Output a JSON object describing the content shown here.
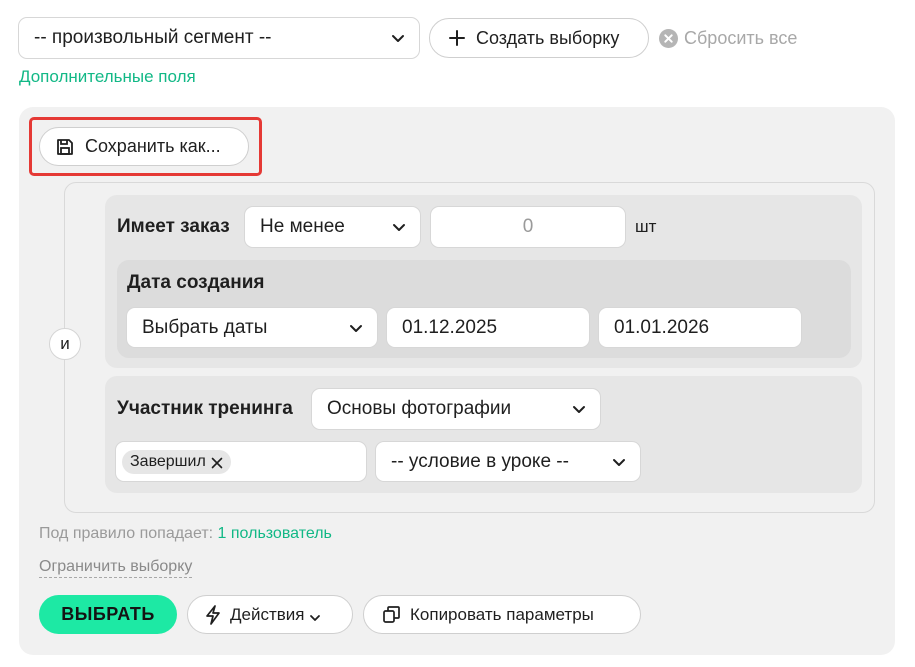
{
  "segment_select": {
    "value": "-- произвольный сегмент --"
  },
  "create_selection_button": {
    "label": "Создать выборку"
  },
  "reset_all": {
    "label": "Сбросить все"
  },
  "extra_fields_link": {
    "label": "Дополнительные поля"
  },
  "save_as_button": {
    "label": "Сохранить как..."
  },
  "and_badge": {
    "label": "и"
  },
  "order_condition": {
    "label": "Имеет заказ",
    "operator": "Не менее",
    "amount_value": "0",
    "unit": "шт",
    "date_group": {
      "label": "Дата создания",
      "date_mode": "Выбрать даты",
      "date_from": "01.12.2025",
      "date_to": "01.01.2026"
    }
  },
  "training_condition": {
    "label": "Участник тренинга",
    "training": "Основы фотографии",
    "status_tag": "Завершил",
    "lesson_condition": "-- условие в уроке --"
  },
  "summary": {
    "prefix": "Под правило попадает:",
    "count_link": "1 пользователь"
  },
  "limit_link": {
    "label": "Ограничить выборку"
  },
  "select_button": {
    "label": "ВЫБРАТЬ"
  },
  "actions_button": {
    "label": "Действия"
  },
  "copy_params_button": {
    "label": "Копировать параметры"
  },
  "colors": {
    "accent": "#12b886",
    "primary_button": "#1de9a4",
    "highlight": "#e53935"
  },
  "icons": [
    "chevron-down-icon",
    "plus-icon",
    "close-circle-icon",
    "save-icon",
    "close-icon",
    "lightning-icon",
    "copy-icon"
  ]
}
